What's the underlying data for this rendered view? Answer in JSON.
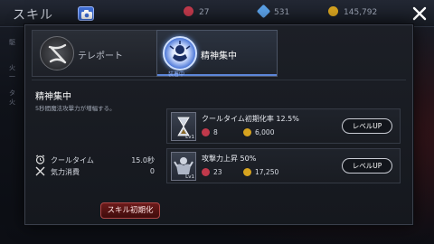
{
  "header": {
    "title": "スキル",
    "resources": [
      {
        "icon": "devil-gem-icon",
        "value": "27",
        "color": "#c0394b"
      },
      {
        "icon": "crystal-icon",
        "value": "531",
        "color": "#5aa0e6"
      },
      {
        "icon": "gold-coin-icon",
        "value": "145,792",
        "color": "#d6a31f"
      }
    ]
  },
  "side_texts": [
    "駆",
    "火",
    "一",
    "タ",
    "火"
  ],
  "tabs": [
    {
      "label": "テレポート",
      "icon": "teleport-swirl-icon",
      "active": false
    },
    {
      "label": "精神集中",
      "icon": "focus-spirit-icon",
      "active": true,
      "badge": "装着中"
    }
  ],
  "skill": {
    "name": "精神集中",
    "description": "5秒間魔法攻撃力が増幅する。",
    "stats": [
      {
        "icon": "alarm-clock-icon",
        "label": "クールタイム",
        "value": "15.0秒"
      },
      {
        "icon": "crossed-swords-icon",
        "label": "気力消費",
        "value": "0"
      }
    ],
    "reset_label": "スキル初期化"
  },
  "upgrades": [
    {
      "icon": "hourglass-icon",
      "level": "Lv1",
      "name": "クールタイム初期化率 12.5%",
      "cost_gems": "8",
      "cost_gold": "6,000",
      "button": "レベルUP"
    },
    {
      "icon": "muscle-warrior-icon",
      "level": "Lv1",
      "name": "攻撃力上昇 50%",
      "cost_gems": "23",
      "cost_gold": "17,250",
      "button": "レベルUP"
    }
  ]
}
